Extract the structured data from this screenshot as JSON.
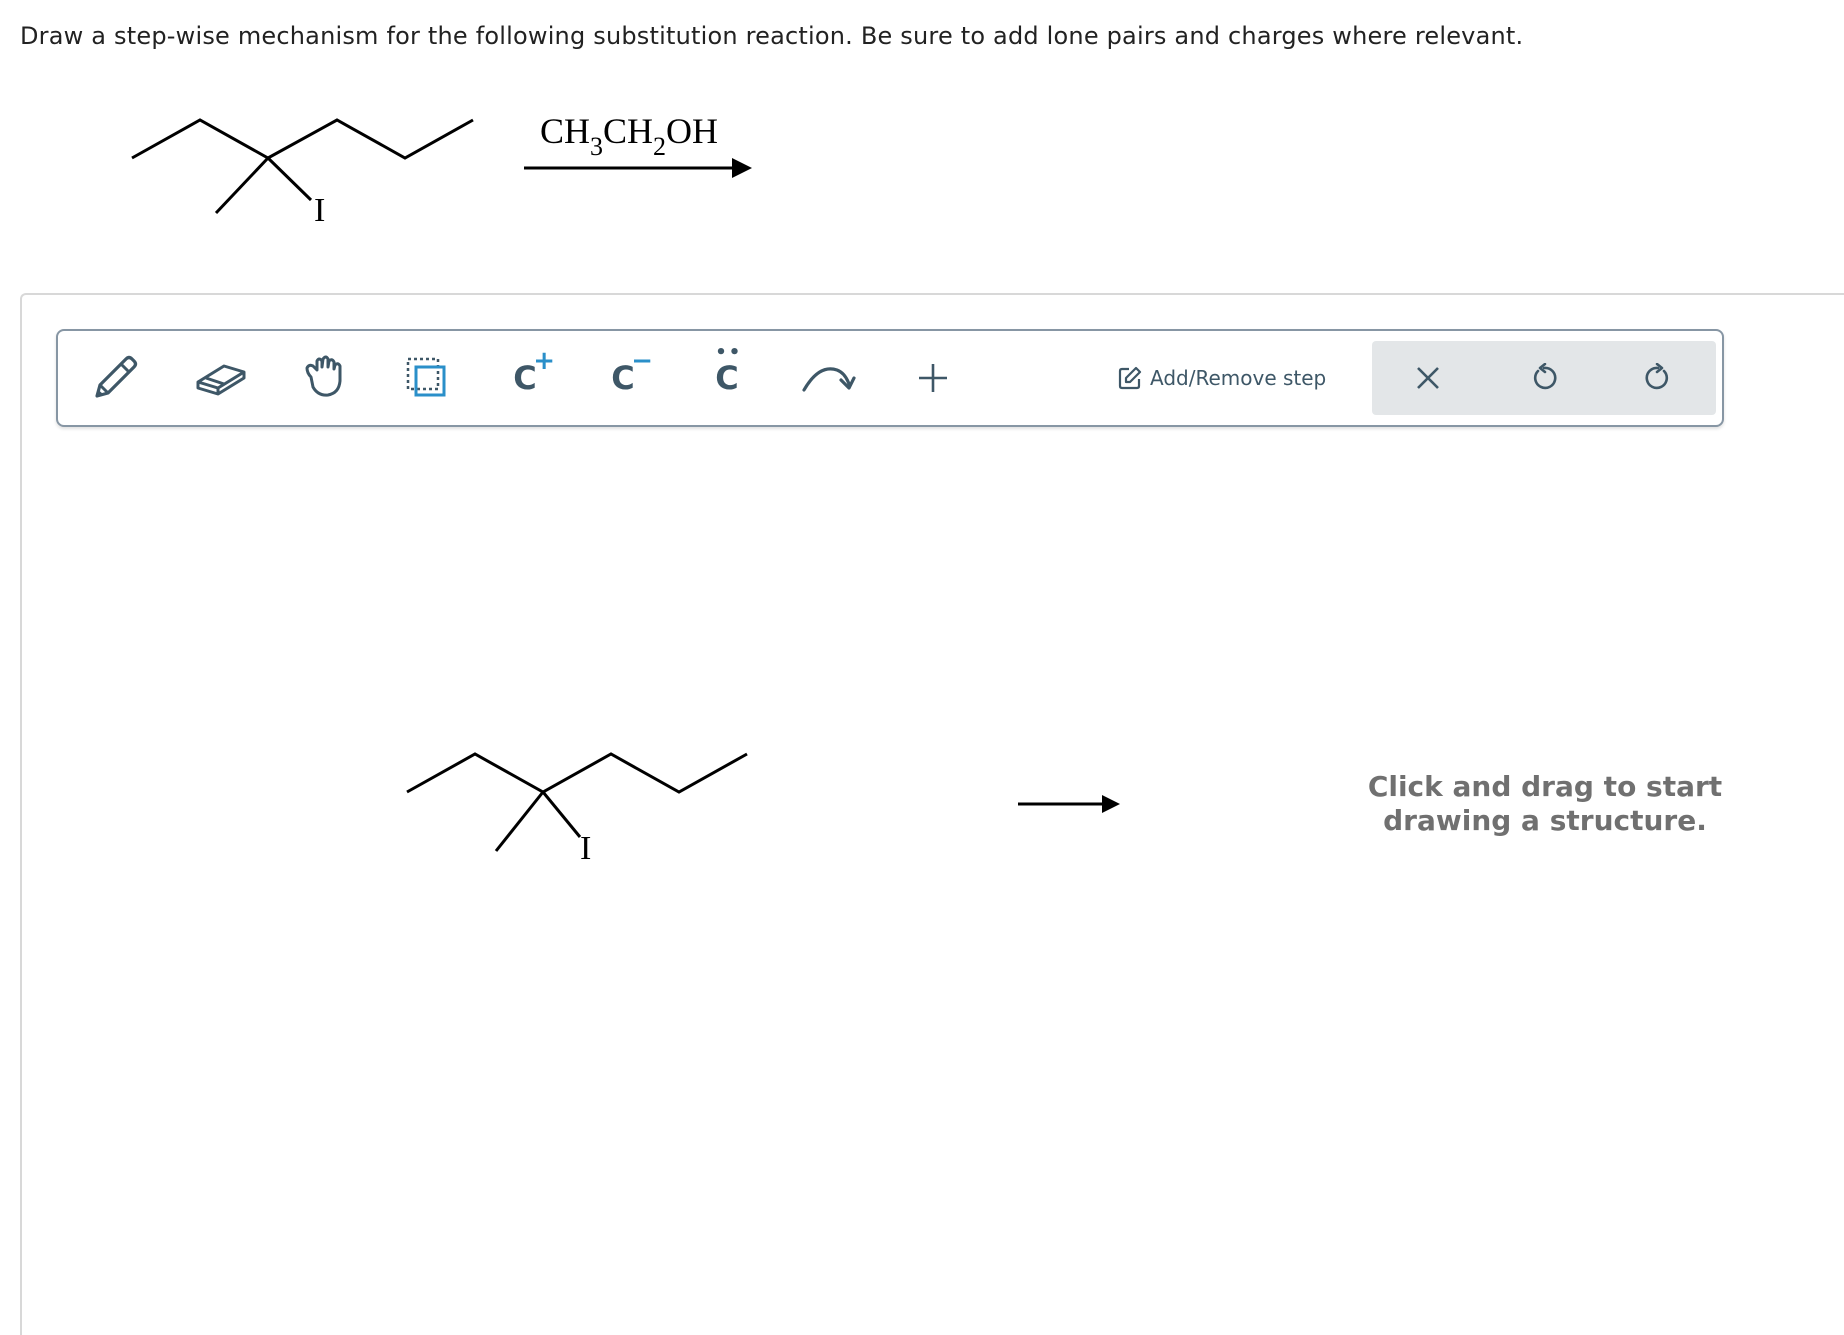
{
  "question": {
    "text": "Draw a step-wise mechanism for the following substitution reaction. Be sure to add lone pairs and charges where relevant."
  },
  "reaction": {
    "reagent": {
      "p1": "CH",
      "s1": "3",
      "p2": "CH",
      "s2": "2",
      "p3": "OH"
    },
    "substituent_label": "I"
  },
  "toolbar": {
    "tools": [
      {
        "icon": "pencil-icon"
      },
      {
        "icon": "eraser-icon"
      },
      {
        "icon": "hand-icon"
      },
      {
        "icon": "select-icon"
      },
      {
        "icon": "cation-icon",
        "label": "C",
        "mark": "+"
      },
      {
        "icon": "anion-icon",
        "label": "C",
        "mark": "−"
      },
      {
        "icon": "lone-pair-icon",
        "label": "C",
        "mark": "••"
      },
      {
        "icon": "curved-arrow-icon"
      },
      {
        "icon": "plus-icon"
      }
    ],
    "step_button_label": "Add/Remove step",
    "actions": [
      {
        "icon": "close-icon"
      },
      {
        "icon": "undo-icon"
      },
      {
        "icon": "redo-icon"
      }
    ],
    "accent_color": "#3e5767",
    "highlight_color": "#2a8fc9"
  },
  "canvas": {
    "substrate_label": "I",
    "hint": "Click and drag to start drawing a structure."
  }
}
